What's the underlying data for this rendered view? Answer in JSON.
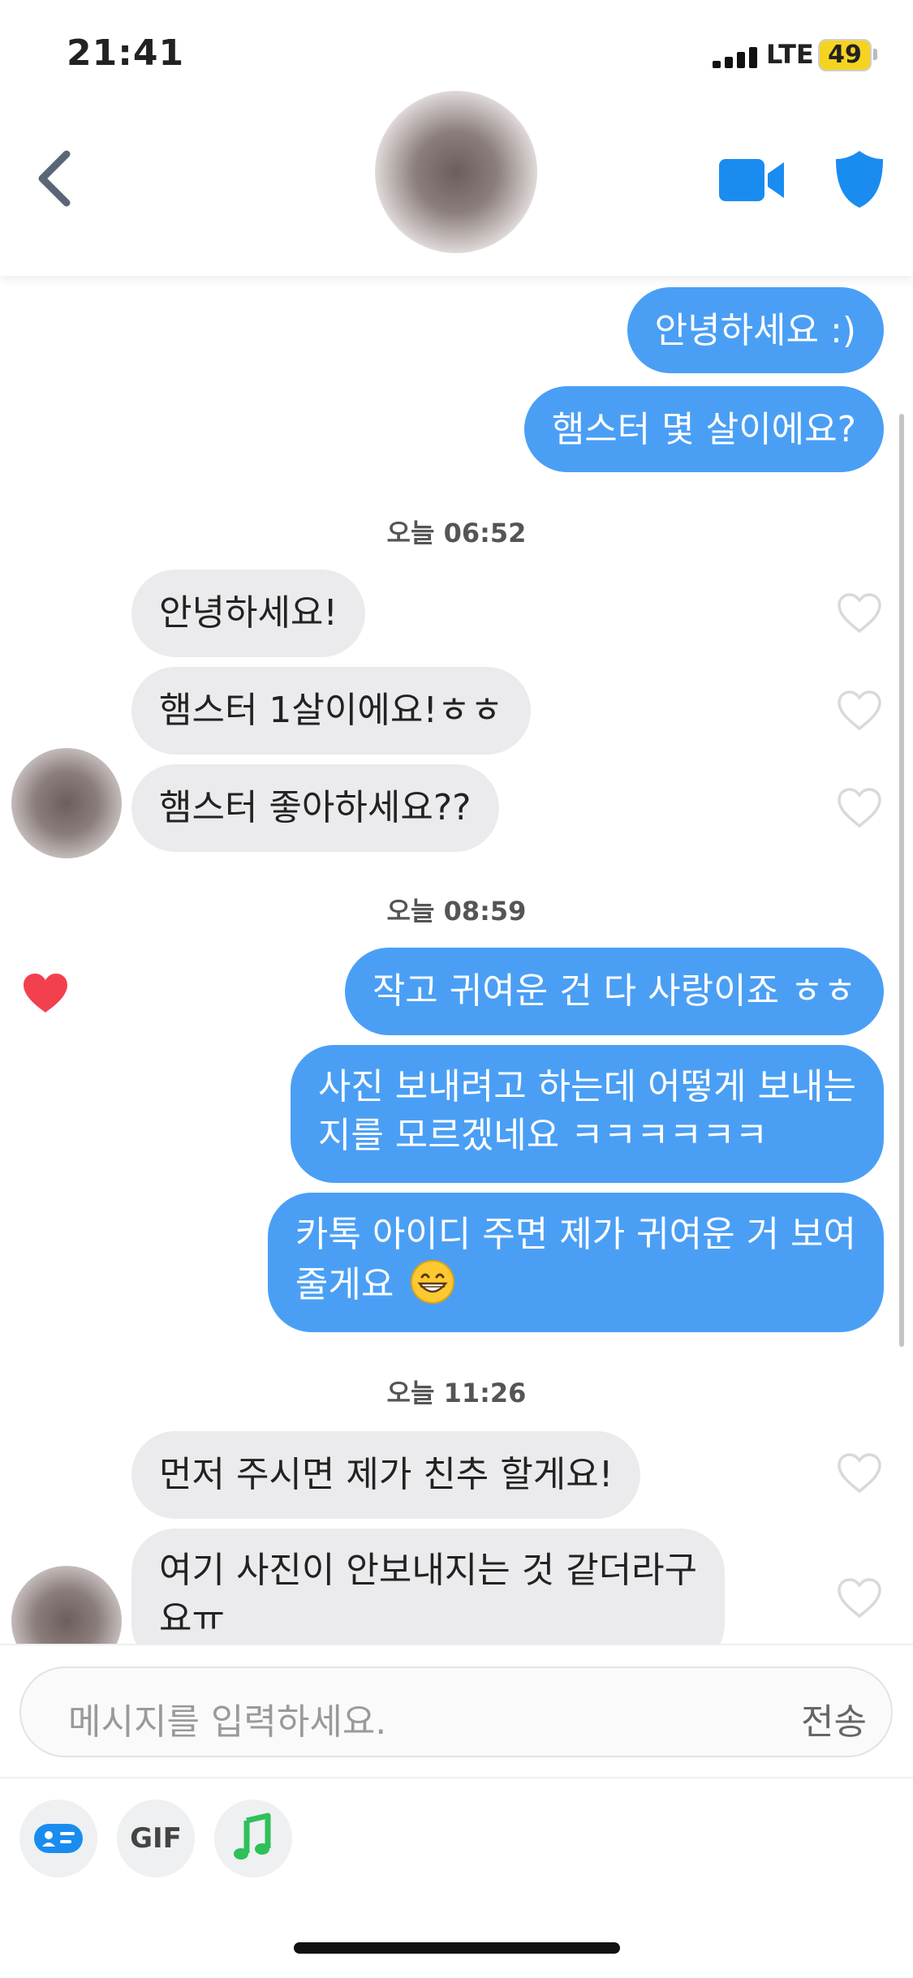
{
  "status_bar": {
    "time": "21:41",
    "network": "LTE",
    "battery": "49"
  },
  "header": {
    "contact_avatar": "blurred-profile-photo"
  },
  "messages": {
    "m1": "안녕하세요 :)",
    "m2": "햄스터 몇 살이에요?",
    "ts1": "오늘 06:52",
    "m3": "안녕하세요!",
    "m4": "햄스터 1살이에요!ㅎㅎ",
    "m5": "햄스터 좋아하세요??",
    "ts2": "오늘 08:59",
    "m6": "작고 귀여운 건 다 사랑이죠 ㅎㅎ",
    "m7_line1": "사진 보내려고 하는데 어떻게 보내는",
    "m7_line2": "지를 모르겠네요 ㅋㅋㅋㅋㅋㅋ",
    "m8_line1": "카톡 아이디 주면 제가 귀여운 거 보여",
    "m8_line2": "줄게요",
    "ts3": "오늘 11:26",
    "m9": "먼저 주시면 제가 친추 할게요!",
    "m10_line1": "여기 사진이 안보내지는 것 같더라구",
    "m10_line2": "요ㅠ"
  },
  "icons": {
    "back": "chevron-left-icon",
    "video": "video-call-icon",
    "shield": "shield-icon",
    "like": "heart-outline-icon",
    "liked": "heart-filled-icon",
    "emoji": "grinning-face-emoji",
    "tool_card": "profile-card-icon",
    "tool_music": "music-note-icon"
  },
  "composer": {
    "placeholder": "메시지를 입력하세요.",
    "send_label": "전송",
    "gif_label": "GIF"
  },
  "colors": {
    "outgoing_bubble": "#4a9ff5",
    "incoming_bubble": "#ebebed",
    "accent_blue": "#1a8cf0",
    "liked_heart": "#f2404f",
    "music_green": "#2fc05a",
    "battery": "#f5d321"
  }
}
